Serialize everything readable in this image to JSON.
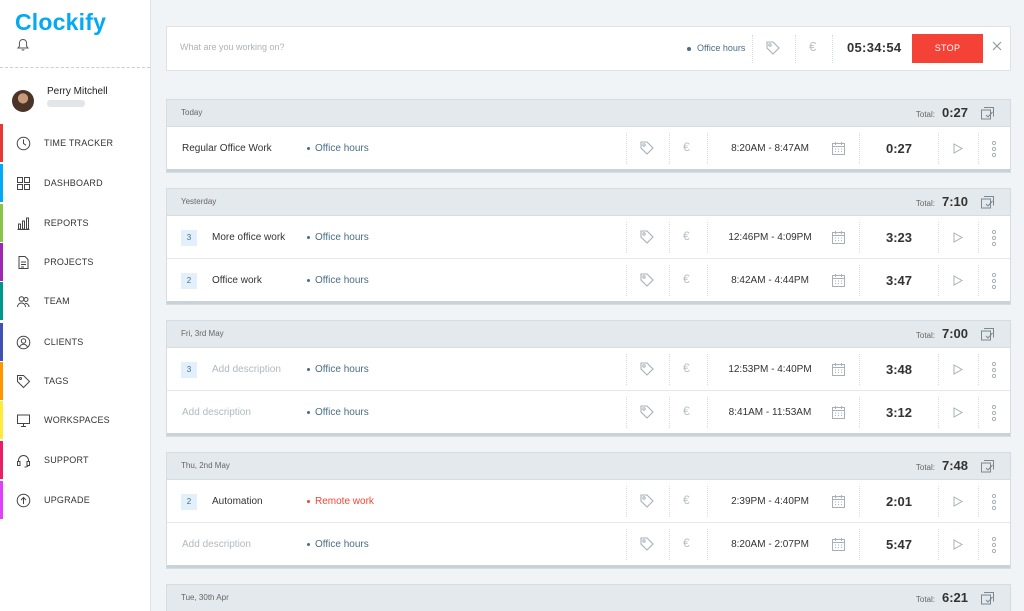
{
  "app": {
    "logo_text": "Clockify"
  },
  "user": {
    "name": "Perry Mitchell"
  },
  "sidebar": {
    "items": [
      {
        "label": "TIME TRACKER",
        "icon": "clock-icon",
        "color": "#e53935"
      },
      {
        "label": "DASHBOARD",
        "icon": "grid-icon",
        "color": "#03a9f4"
      },
      {
        "label": "REPORTS",
        "icon": "bar-chart-icon",
        "color": "#8bc34a"
      },
      {
        "label": "PROJECTS",
        "icon": "document-icon",
        "color": "#9c27b0"
      },
      {
        "label": "TEAM",
        "icon": "team-icon",
        "color": "#009688"
      },
      {
        "label": "CLIENTS",
        "icon": "client-icon",
        "color": "#3f51b5"
      },
      {
        "label": "TAGS",
        "icon": "tag-icon",
        "color": "#ff9800"
      },
      {
        "label": "WORKSPACES",
        "icon": "monitor-icon",
        "color": "#ffeb3b"
      },
      {
        "label": "SUPPORT",
        "icon": "headset-icon",
        "color": "#e91e63"
      },
      {
        "label": "UPGRADE",
        "icon": "upgrade-icon",
        "color": "#e040fb"
      }
    ]
  },
  "timer": {
    "placeholder": "What are you working on?",
    "project": "Office hours",
    "time": "05:34:54",
    "stop_label": "STOP"
  },
  "colors": {
    "accent": "#03a9f4",
    "stop": "#f44336",
    "project": "#4a6d84",
    "remote": "#f44336"
  },
  "days": [
    {
      "date": "Today",
      "total_label": "Total:",
      "total": "0:27",
      "entries": [
        {
          "count": "",
          "description": "Regular Office Work",
          "placeholder": false,
          "project": "Office hours",
          "project_color": "blue",
          "range": "8:20AM - 8:47AM",
          "duration": "0:27"
        }
      ]
    },
    {
      "date": "Yesterday",
      "total_label": "Total:",
      "total": "7:10",
      "entries": [
        {
          "count": "3",
          "description": "More office work",
          "placeholder": false,
          "project": "Office hours",
          "project_color": "blue",
          "range": "12:46PM - 4:09PM",
          "duration": "3:23"
        },
        {
          "count": "2",
          "description": "Office work",
          "placeholder": false,
          "project": "Office hours",
          "project_color": "blue",
          "range": "8:42AM - 4:44PM",
          "duration": "3:47"
        }
      ]
    },
    {
      "date": "Fri, 3rd May",
      "total_label": "Total:",
      "total": "7:00",
      "entries": [
        {
          "count": "3",
          "description": "Add description",
          "placeholder": true,
          "project": "Office hours",
          "project_color": "blue",
          "range": "12:53PM - 4:40PM",
          "duration": "3:48"
        },
        {
          "count": "",
          "description": "Add description",
          "placeholder": true,
          "project": "Office hours",
          "project_color": "blue",
          "range": "8:41AM - 11:53AM",
          "duration": "3:12"
        }
      ]
    },
    {
      "date": "Thu, 2nd May",
      "total_label": "Total:",
      "total": "7:48",
      "entries": [
        {
          "count": "2",
          "description": "Automation",
          "placeholder": false,
          "project": "Remote work",
          "project_color": "red",
          "range": "2:39PM - 4:40PM",
          "duration": "2:01"
        },
        {
          "count": "",
          "description": "Add description",
          "placeholder": true,
          "project": "Office hours",
          "project_color": "blue",
          "range": "8:20AM - 2:07PM",
          "duration": "5:47"
        }
      ]
    },
    {
      "date": "Tue, 30th Apr",
      "total_label": "Total:",
      "total": "6:21",
      "entries": []
    }
  ]
}
